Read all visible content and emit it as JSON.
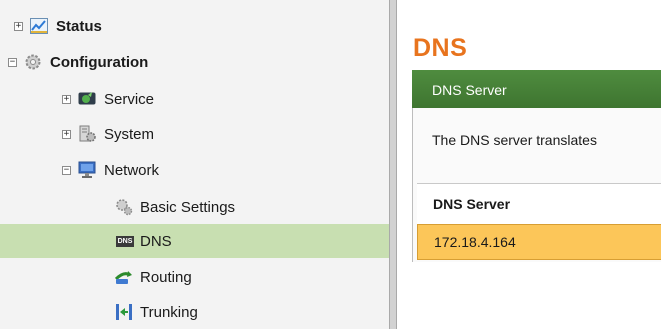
{
  "sidebar": {
    "items": [
      {
        "label": "Status",
        "icon": "status-chart-icon",
        "toggle": "+"
      },
      {
        "label": "Configuration",
        "icon": "configuration-gear-icon",
        "toggle": "−"
      },
      {
        "label": "Service",
        "icon": "service-icon",
        "toggle": "+"
      },
      {
        "label": "System",
        "icon": "system-icon",
        "toggle": "+"
      },
      {
        "label": "Network",
        "icon": "network-monitor-icon",
        "toggle": "−"
      },
      {
        "label": "Basic Settings",
        "icon": "basic-settings-gears-icon"
      },
      {
        "label": "DNS",
        "icon": "dns-icon",
        "icon_text": "DNS",
        "selected": true
      },
      {
        "label": "Routing",
        "icon": "routing-icon"
      },
      {
        "label": "Trunking",
        "icon": "trunking-icon"
      }
    ]
  },
  "main": {
    "title": "DNS",
    "panel": {
      "header": "DNS Server",
      "description": "The DNS server translates",
      "table": {
        "column_header": "DNS Server",
        "rows": [
          "172.18.4.164"
        ]
      }
    }
  },
  "colors": {
    "title_orange": "#e8741e",
    "panel_header_green": "#3e7530",
    "selected_row_green": "#c8dfb1",
    "table_row_yellow": "#fcc659",
    "sidebar_bg": "#f3f3f3"
  }
}
